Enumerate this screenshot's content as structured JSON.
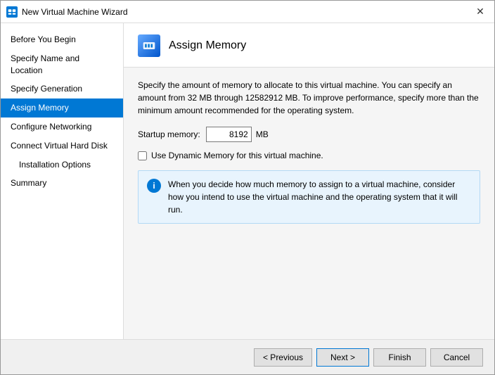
{
  "window": {
    "title": "New Virtual Machine Wizard",
    "close_label": "✕"
  },
  "header": {
    "title": "Assign Memory",
    "icon_alt": "memory-icon"
  },
  "sidebar": {
    "items": [
      {
        "id": "before-you-begin",
        "label": "Before You Begin",
        "active": false,
        "sub": false
      },
      {
        "id": "specify-name",
        "label": "Specify Name and Location",
        "active": false,
        "sub": false
      },
      {
        "id": "specify-generation",
        "label": "Specify Generation",
        "active": false,
        "sub": false
      },
      {
        "id": "assign-memory",
        "label": "Assign Memory",
        "active": true,
        "sub": false
      },
      {
        "id": "configure-networking",
        "label": "Configure Networking",
        "active": false,
        "sub": false
      },
      {
        "id": "connect-virtual-hard-disk",
        "label": "Connect Virtual Hard Disk",
        "active": false,
        "sub": false
      },
      {
        "id": "installation-options",
        "label": "Installation Options",
        "active": false,
        "sub": true
      },
      {
        "id": "summary",
        "label": "Summary",
        "active": false,
        "sub": false
      }
    ]
  },
  "main": {
    "description": "Specify the amount of memory to allocate to this virtual machine. You can specify an amount from 32 MB through 12582912 MB. To improve performance, specify more than the minimum amount recommended for the operating system.",
    "startup_memory_label": "Startup memory:",
    "startup_memory_value": "8192",
    "startup_memory_unit": "MB",
    "dynamic_memory_label": "Use Dynamic Memory for this virtual machine.",
    "info_text": "When you decide how much memory to assign to a virtual machine, consider how you intend to use the virtual machine and the operating system that it will run."
  },
  "footer": {
    "previous_label": "< Previous",
    "next_label": "Next >",
    "finish_label": "Finish",
    "cancel_label": "Cancel"
  }
}
